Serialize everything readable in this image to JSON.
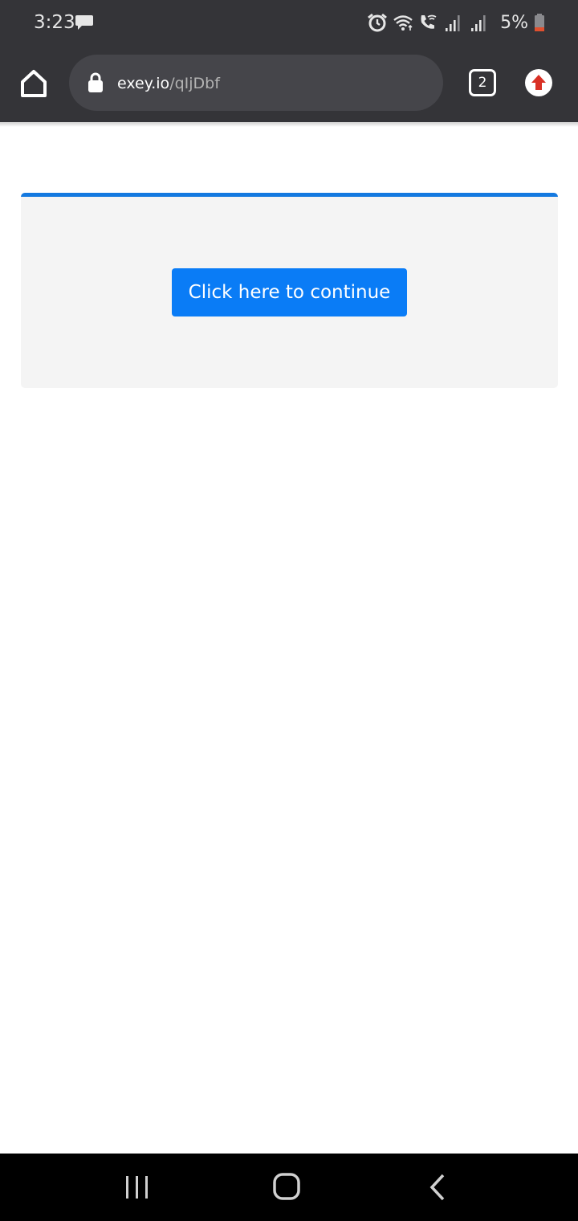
{
  "status_bar": {
    "time": "3:23",
    "battery_percent": "5%",
    "icons": [
      "message-icon",
      "alarm-icon",
      "wifi-icon",
      "wifi-calling-icon",
      "signal-icon",
      "signal-icon",
      "battery-low-icon"
    ]
  },
  "browser": {
    "url_domain": "exey.io",
    "url_path": "/qIjDbf",
    "tab_count": "2",
    "icons": [
      "home-icon",
      "lock-icon",
      "tab-switcher-icon",
      "update-arrow-icon"
    ],
    "colors": {
      "toolbar": "#343438",
      "url_bar": "#45454a",
      "update_arrow": "#d93025"
    }
  },
  "page": {
    "continue_button_label": "Click here to continue",
    "colors": {
      "card_background": "#f4f4f4",
      "card_accent": "#1479e0",
      "button": "#0a7cf6"
    }
  },
  "nav_bar": {
    "icons": [
      "recent-apps-icon",
      "home-icon",
      "back-icon"
    ]
  }
}
